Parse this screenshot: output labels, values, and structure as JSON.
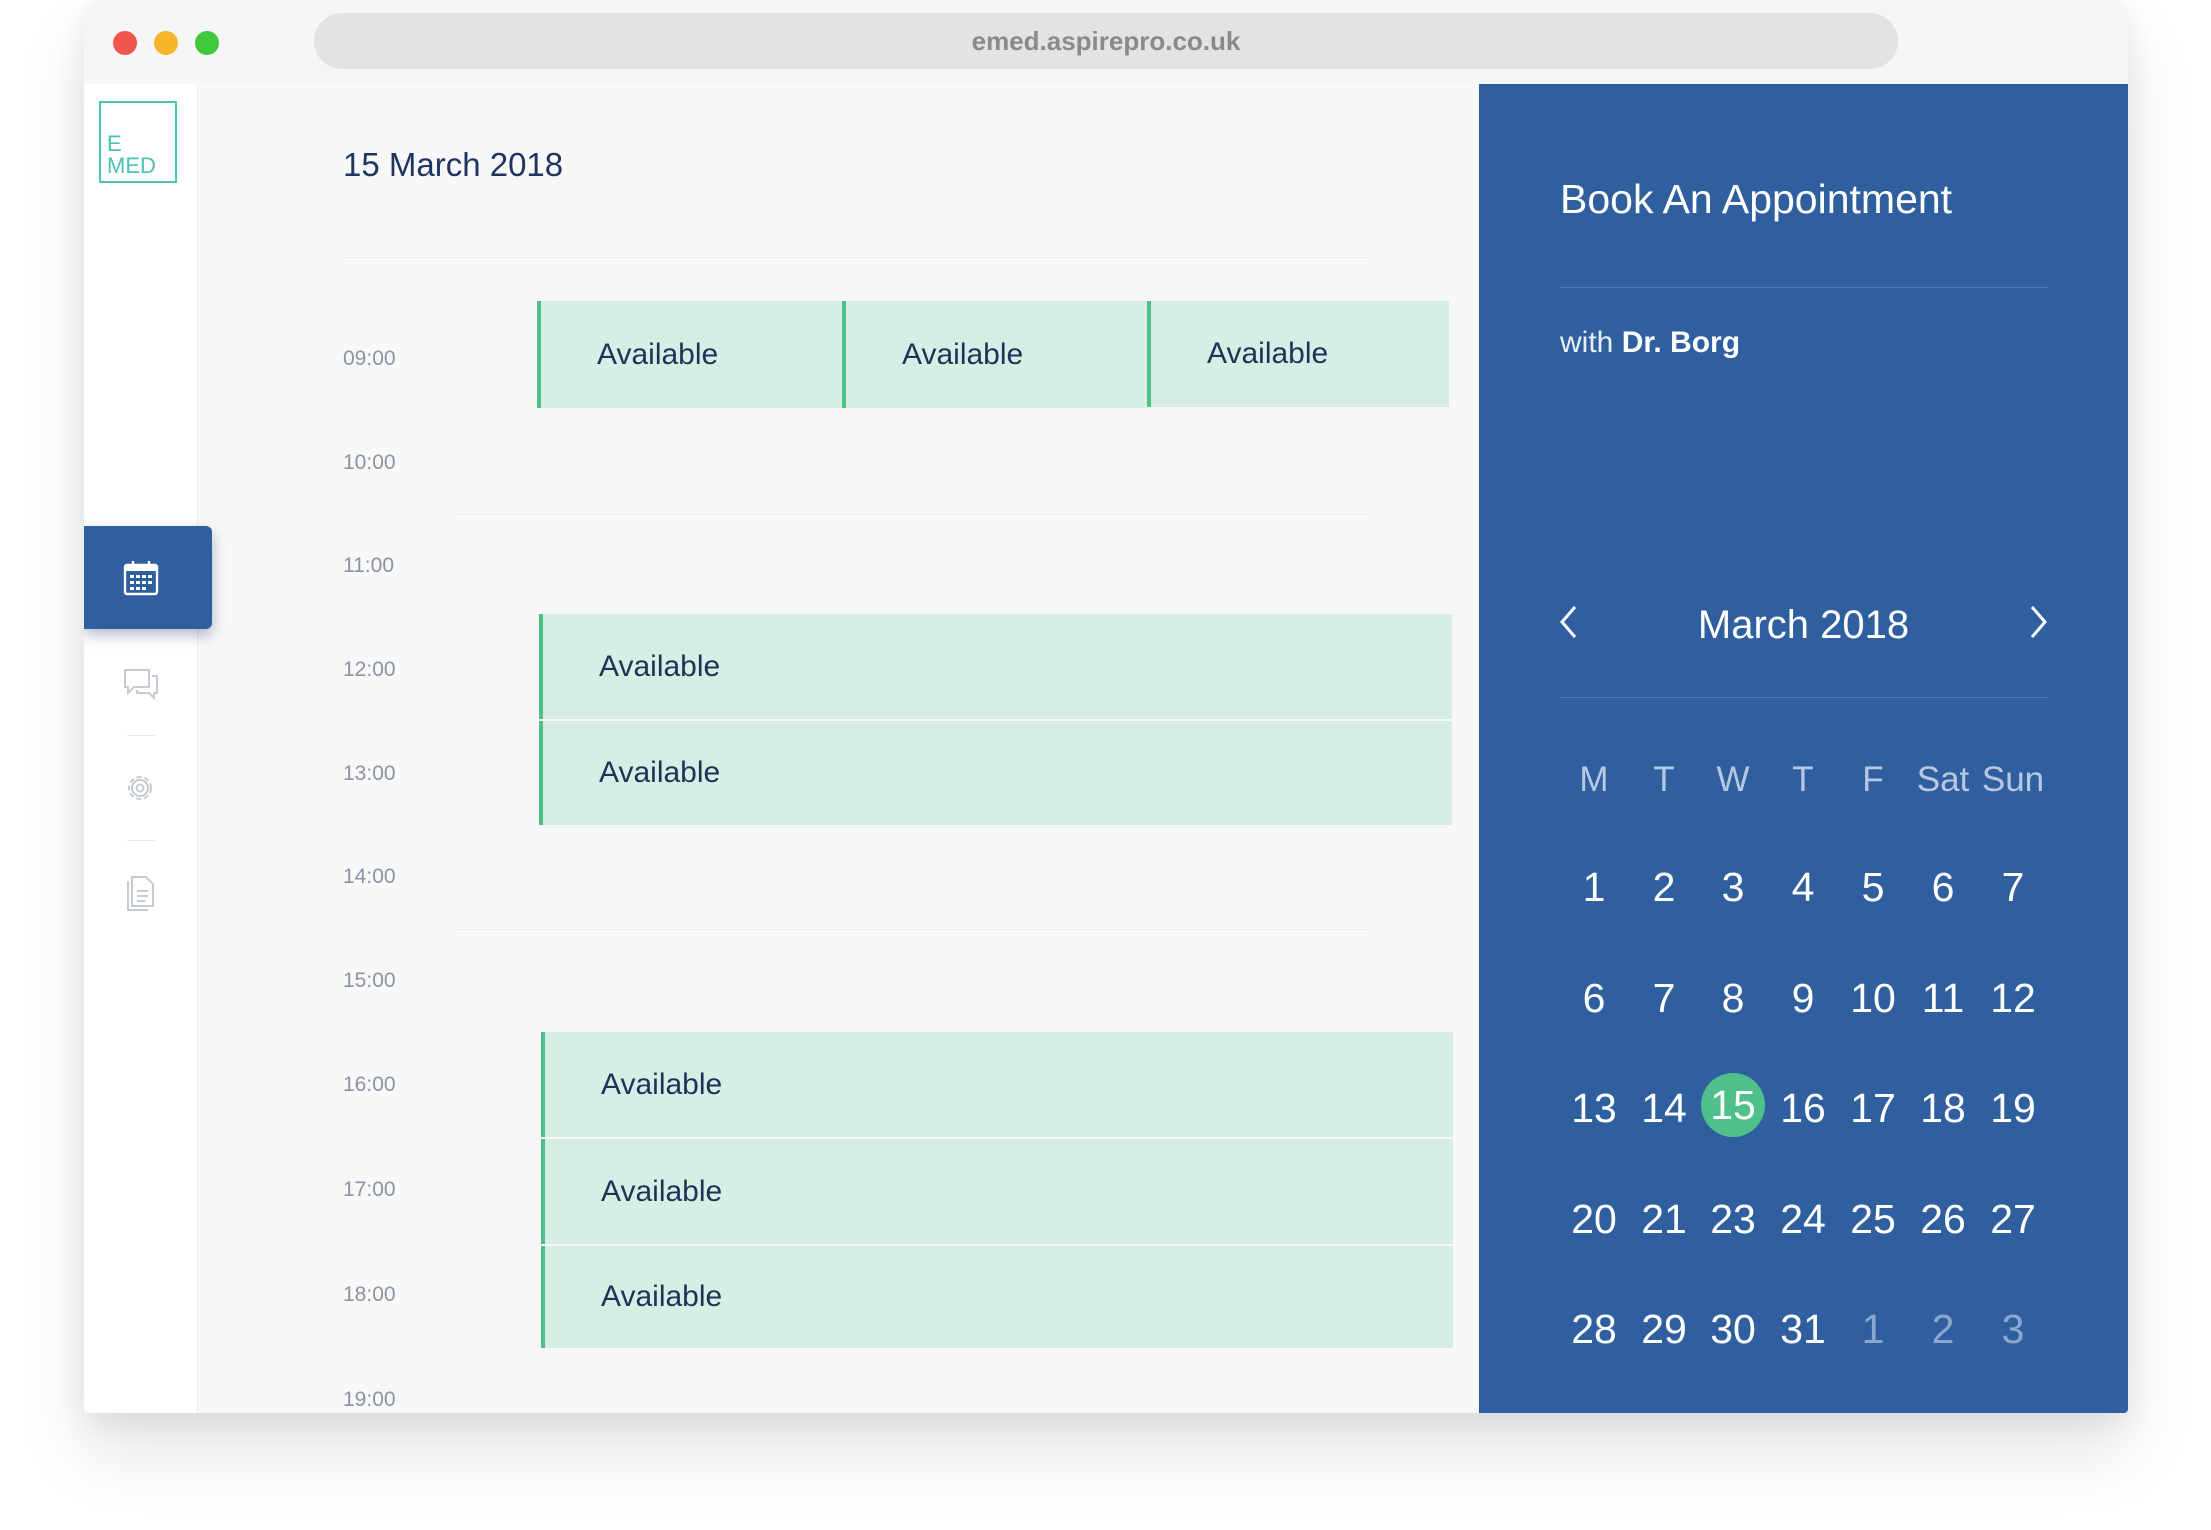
{
  "browser": {
    "url": "emed.aspirepro.co.uk"
  },
  "logo": {
    "line1": "E",
    "line2": "MED"
  },
  "nav": [
    "calendar-icon",
    "chat-icon",
    "settings-icon",
    "document-icon"
  ],
  "schedule": {
    "date": "15 March 2018",
    "times": [
      "09:00",
      "10:00",
      "11:00",
      "12:00",
      "13:00",
      "14:00",
      "15:00",
      "16:00",
      "17:00",
      "18:00",
      "19:00"
    ],
    "slots": [
      {
        "time": "09:00",
        "label": "Available"
      },
      {
        "time": "09:00",
        "label": "Available"
      },
      {
        "time": "09:00",
        "label": "Available"
      },
      {
        "time": "12:00",
        "label": "Available"
      },
      {
        "time": "13:00",
        "label": "Available"
      },
      {
        "time": "16:00",
        "label": "Available"
      },
      {
        "time": "17:00",
        "label": "Available"
      },
      {
        "time": "18:00",
        "label": "Available"
      }
    ]
  },
  "booking": {
    "title": "Book An Appointment",
    "with_prefix": "with",
    "doctor": "Dr. Borg",
    "calendar": {
      "month": "March 2018",
      "weekdays": [
        "M",
        "T",
        "W",
        "T",
        "F",
        "Sat",
        "Sun"
      ],
      "weeks": [
        [
          "1",
          "2",
          "3",
          "4",
          "5",
          "6",
          "7"
        ],
        [
          "6",
          "7",
          "8",
          "9",
          "10",
          "11",
          "12"
        ],
        [
          "13",
          "14",
          "15",
          "16",
          "17",
          "18",
          "19"
        ],
        [
          "20",
          "21",
          "23",
          "24",
          "25",
          "26",
          "27"
        ],
        [
          "28",
          "29",
          "30",
          "31",
          "1",
          "2",
          "3"
        ]
      ],
      "selected_day": "15",
      "next_month_days_in_last_row": [
        "1",
        "2",
        "3"
      ]
    }
  },
  "colors": {
    "panel_blue": "#2f5f9f",
    "slot_fill": "#d6eee3",
    "slot_accent": "#4fc08a",
    "selected_day": "#4fc08a",
    "logo_teal": "#4cc2b0"
  }
}
